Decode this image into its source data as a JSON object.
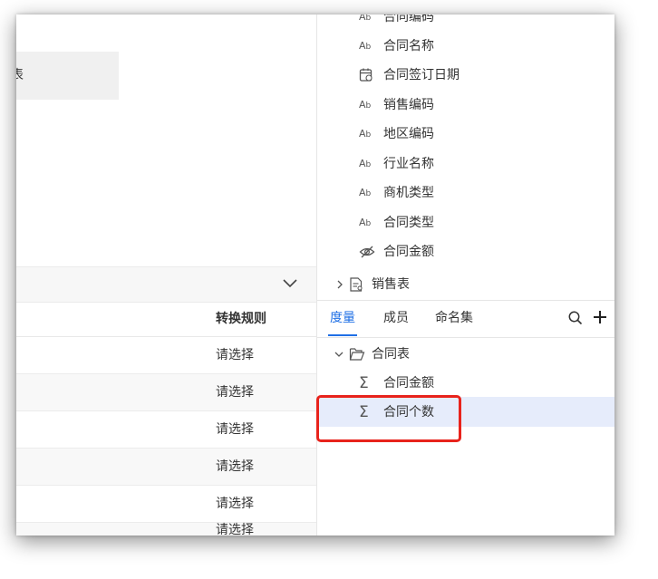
{
  "left": {
    "tab_chip": "表",
    "table": {
      "header": "转换规则",
      "rows": [
        "请选择",
        "请选择",
        "请选择",
        "请选择",
        "请选择",
        "请选择"
      ]
    }
  },
  "right": {
    "fields": [
      {
        "icon": "text-type-icon",
        "label": "合同编码"
      },
      {
        "icon": "text-type-icon",
        "label": "合同名称"
      },
      {
        "icon": "date-type-icon",
        "label": "合同签订日期"
      },
      {
        "icon": "text-type-icon",
        "label": "销售编码"
      },
      {
        "icon": "text-type-icon",
        "label": "地区编码"
      },
      {
        "icon": "text-type-icon",
        "label": "行业名称"
      },
      {
        "icon": "text-type-icon",
        "label": "商机类型"
      },
      {
        "icon": "text-type-icon",
        "label": "合同类型"
      },
      {
        "icon": "hidden-eye-icon",
        "label": "合同金额"
      }
    ],
    "collapsed_table": "销售表",
    "tabs": [
      "度量",
      "成员",
      "命名集"
    ],
    "active_tab": "度量",
    "tree": {
      "folder": "合同表",
      "measures": [
        "合同金额",
        "合同个数"
      ],
      "selected": "合同个数"
    }
  },
  "colors": {
    "accent": "#1f6fe5",
    "highlight": "#e8231c",
    "selection": "#e6ecfb"
  }
}
